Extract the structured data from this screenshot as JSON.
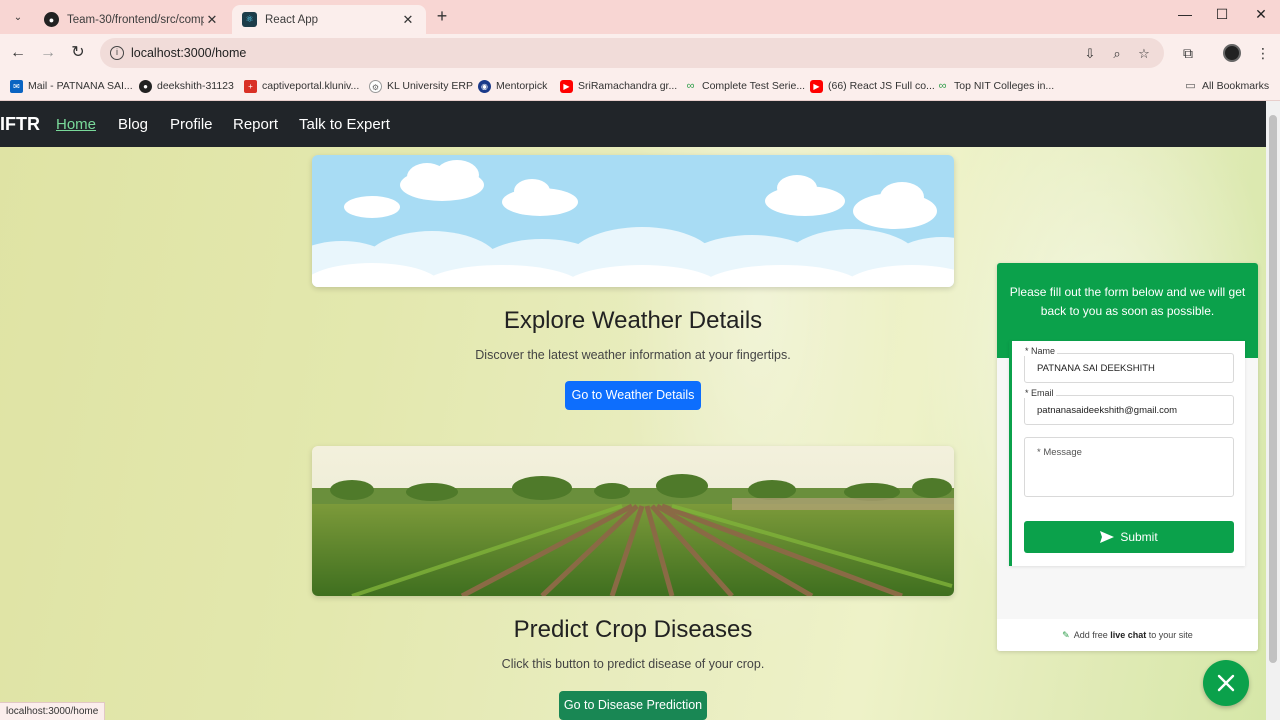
{
  "browser": {
    "tabs": [
      {
        "title": "Team-30/frontend/src/compon",
        "active": false,
        "icon": "github-icon"
      },
      {
        "title": "React App",
        "active": true,
        "icon": "react-icon"
      }
    ],
    "url": "localhost:3000/home",
    "bookmarks": [
      {
        "label": "Mail - PATNANA SAI...",
        "icon": "outlook-icon",
        "color": "#0a64c2"
      },
      {
        "label": "deekshith-31123",
        "icon": "github-icon",
        "color": "#222222"
      },
      {
        "label": "captiveportal.kluniv...",
        "icon": "portal-icon",
        "color": "#d93025"
      },
      {
        "label": "KL University ERP",
        "icon": "gear-icon",
        "color": "#666666"
      },
      {
        "label": "Mentorpick",
        "icon": "mentorpick-icon",
        "color": "#1a3a8a"
      },
      {
        "label": "SriRamachandra gr...",
        "icon": "youtube-icon",
        "color": "#ff0000"
      },
      {
        "label": "Complete Test Serie...",
        "icon": "testbook-icon",
        "color": "#2e9d4a"
      },
      {
        "label": "(66) React JS Full co...",
        "icon": "youtube-icon",
        "color": "#ff0000"
      },
      {
        "label": "Top NIT Colleges in...",
        "icon": "testbook-icon",
        "color": "#2e9d4a"
      }
    ],
    "all_bookmarks": "All Bookmarks",
    "status_url": "localhost:3000/home"
  },
  "navbar": {
    "brand": "IFTR",
    "links": [
      "Home",
      "Blog",
      "Profile",
      "Report",
      "Talk to Expert"
    ],
    "active": "Home"
  },
  "weather": {
    "title": "Explore Weather Details",
    "description": "Discover the latest weather information at your fingertips.",
    "button": "Go to Weather Details",
    "button_color": "#0d6efd"
  },
  "disease": {
    "title": "Predict Crop Diseases",
    "description": "Click this button to predict disease of your crop.",
    "button": "Go to Disease Prediction",
    "button_color": "#198754"
  },
  "chat": {
    "header": "Please fill out the form below and we will get back to you as soon as possible.",
    "name_label": "* Name",
    "name_value": "PATNANA SAI DEEKSHITH",
    "email_label": "* Email",
    "email_value": "patnanasaideekshith@gmail.com",
    "message_placeholder": "* Message",
    "submit": "Submit",
    "footer_prefix": "Add free ",
    "footer_bold": "live chat",
    "footer_suffix": " to your site",
    "accent": "#0ba14b"
  }
}
